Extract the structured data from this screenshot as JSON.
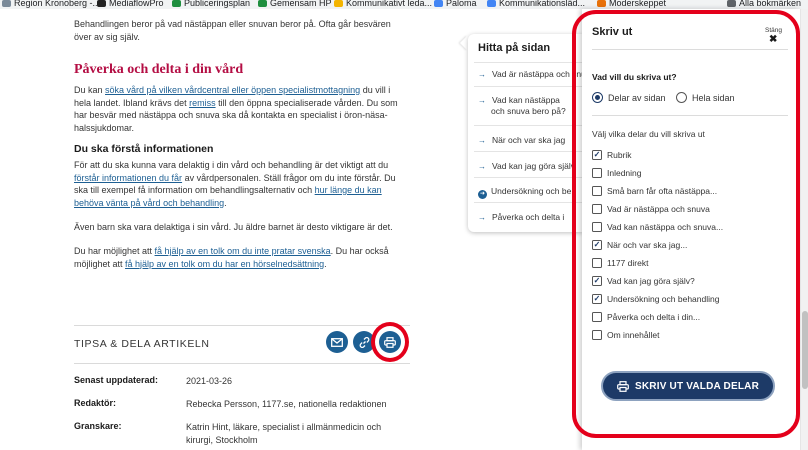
{
  "bookmarks": [
    {
      "label": "Region Kronoberg -...",
      "color": "#7a8a99"
    },
    {
      "label": "MediaflowPro",
      "color": "#222222"
    },
    {
      "label": "Publiceringsplan",
      "color": "#1e8e3e"
    },
    {
      "label": "Gemensam HP",
      "color": "#1e8e3e"
    },
    {
      "label": "Kommunikativt leda...",
      "color": "#f4b400"
    },
    {
      "label": "Paloma",
      "color": "#4285f4"
    },
    {
      "label": "Kommunikationsläd...",
      "color": "#4285f4"
    },
    {
      "label": "Moderskeppet",
      "color": "#e8710a"
    },
    {
      "label": "Alla bokmärken",
      "color": "#5f6368"
    }
  ],
  "article": {
    "intro_line1": "Behandlingen beror på vad nästäppan eller snuvan beror på. Ofta går besvären",
    "intro_line2": "över av sig själv.",
    "h2": "Påverka och delta i din vård",
    "p1_a": "Du kan ",
    "p1_link1": "söka vård på vilken vårdcentral eller öppen specialistmottagning",
    "p1_b": " du vill i hela landet. Ibland krävs det ",
    "p1_link2": "remiss",
    "p1_c": " till den öppna specialiserade vården. Du som har besvär med nästäppa och snuva ska då kontakta en specialist i öron-näsa-halssjukdomar.",
    "h3": "Du ska förstå informationen",
    "p2_a": "För att du ska kunna vara delaktig i din vård och behandling är det viktigt att du ",
    "p2_link1": "förstår informationen du får",
    "p2_b": " av vårdpersonalen. Ställ frågor om du inte förstår. Du ska till exempel få information om behandlingsalternativ och ",
    "p2_link2": "hur länge du kan behöva vänta på vård och behandling",
    "p2_c": ".",
    "p3": "Även barn ska vara delaktiga i sin vård. Ju äldre barnet är desto viktigare är det.",
    "p4_a": "Du har möjlighet att ",
    "p4_link1": "få hjälp av en tolk om du inte pratar svenska",
    "p4_b": ". Du har också möjlighet att ",
    "p4_link2": "få hjälp av en tolk om du har en hörselnedsättning",
    "p4_c": "."
  },
  "toc": {
    "title": "Hitta på sidan",
    "items": [
      "Vad är nästäppa och snuva",
      "Vad kan nästäppa och snuva bero på?",
      "När och var ska jag",
      "Vad kan jag göra själv",
      "Undersökning och be",
      "Påverka och delta i"
    ]
  },
  "share": {
    "label": "TIPSA & DELA ARTIKELN"
  },
  "meta": [
    {
      "key": "Senast uppdaterad:",
      "value": "2021-03-26"
    },
    {
      "key": "Redaktör:",
      "value": "Rebecka Persson, 1177.se, nationella redaktionen"
    },
    {
      "key": "Granskare:",
      "value": "Katrin Hint, läkare, specialist i allmänmedicin och kirurgi, Stockholm"
    }
  ],
  "print_panel": {
    "title": "Skriv ut",
    "close_label": "Stäng",
    "close_glyph": "✖",
    "question": "Vad vill du skriva ut?",
    "radios": [
      {
        "label": "Delar av sidan",
        "selected": true
      },
      {
        "label": "Hela sidan",
        "selected": false
      }
    ],
    "parts_label": "Välj vilka delar du vill skriva ut",
    "parts": [
      {
        "label": "Rubrik",
        "checked": true
      },
      {
        "label": "Inledning",
        "checked": false
      },
      {
        "label": "Små barn får ofta nästäppa...",
        "checked": false
      },
      {
        "label": "Vad är nästäppa och snuva",
        "checked": false
      },
      {
        "label": "Vad kan nästäppa och snuva...",
        "checked": false
      },
      {
        "label": "När och var ska jag...",
        "checked": true
      },
      {
        "label": "1177 direkt",
        "checked": false
      },
      {
        "label": "Vad kan jag göra själv?",
        "checked": true
      },
      {
        "label": "Undersökning och behandling",
        "checked": true
      },
      {
        "label": "Påverka och delta i din...",
        "checked": false
      },
      {
        "label": "Om innehållet",
        "checked": false
      }
    ],
    "print_button": "SKRIV UT VALDA DELAR"
  },
  "colors": {
    "accent": "#1d5f93",
    "button_dark": "#1d3a67",
    "heading_red": "#b40e44",
    "highlight_red": "#e4001b"
  }
}
